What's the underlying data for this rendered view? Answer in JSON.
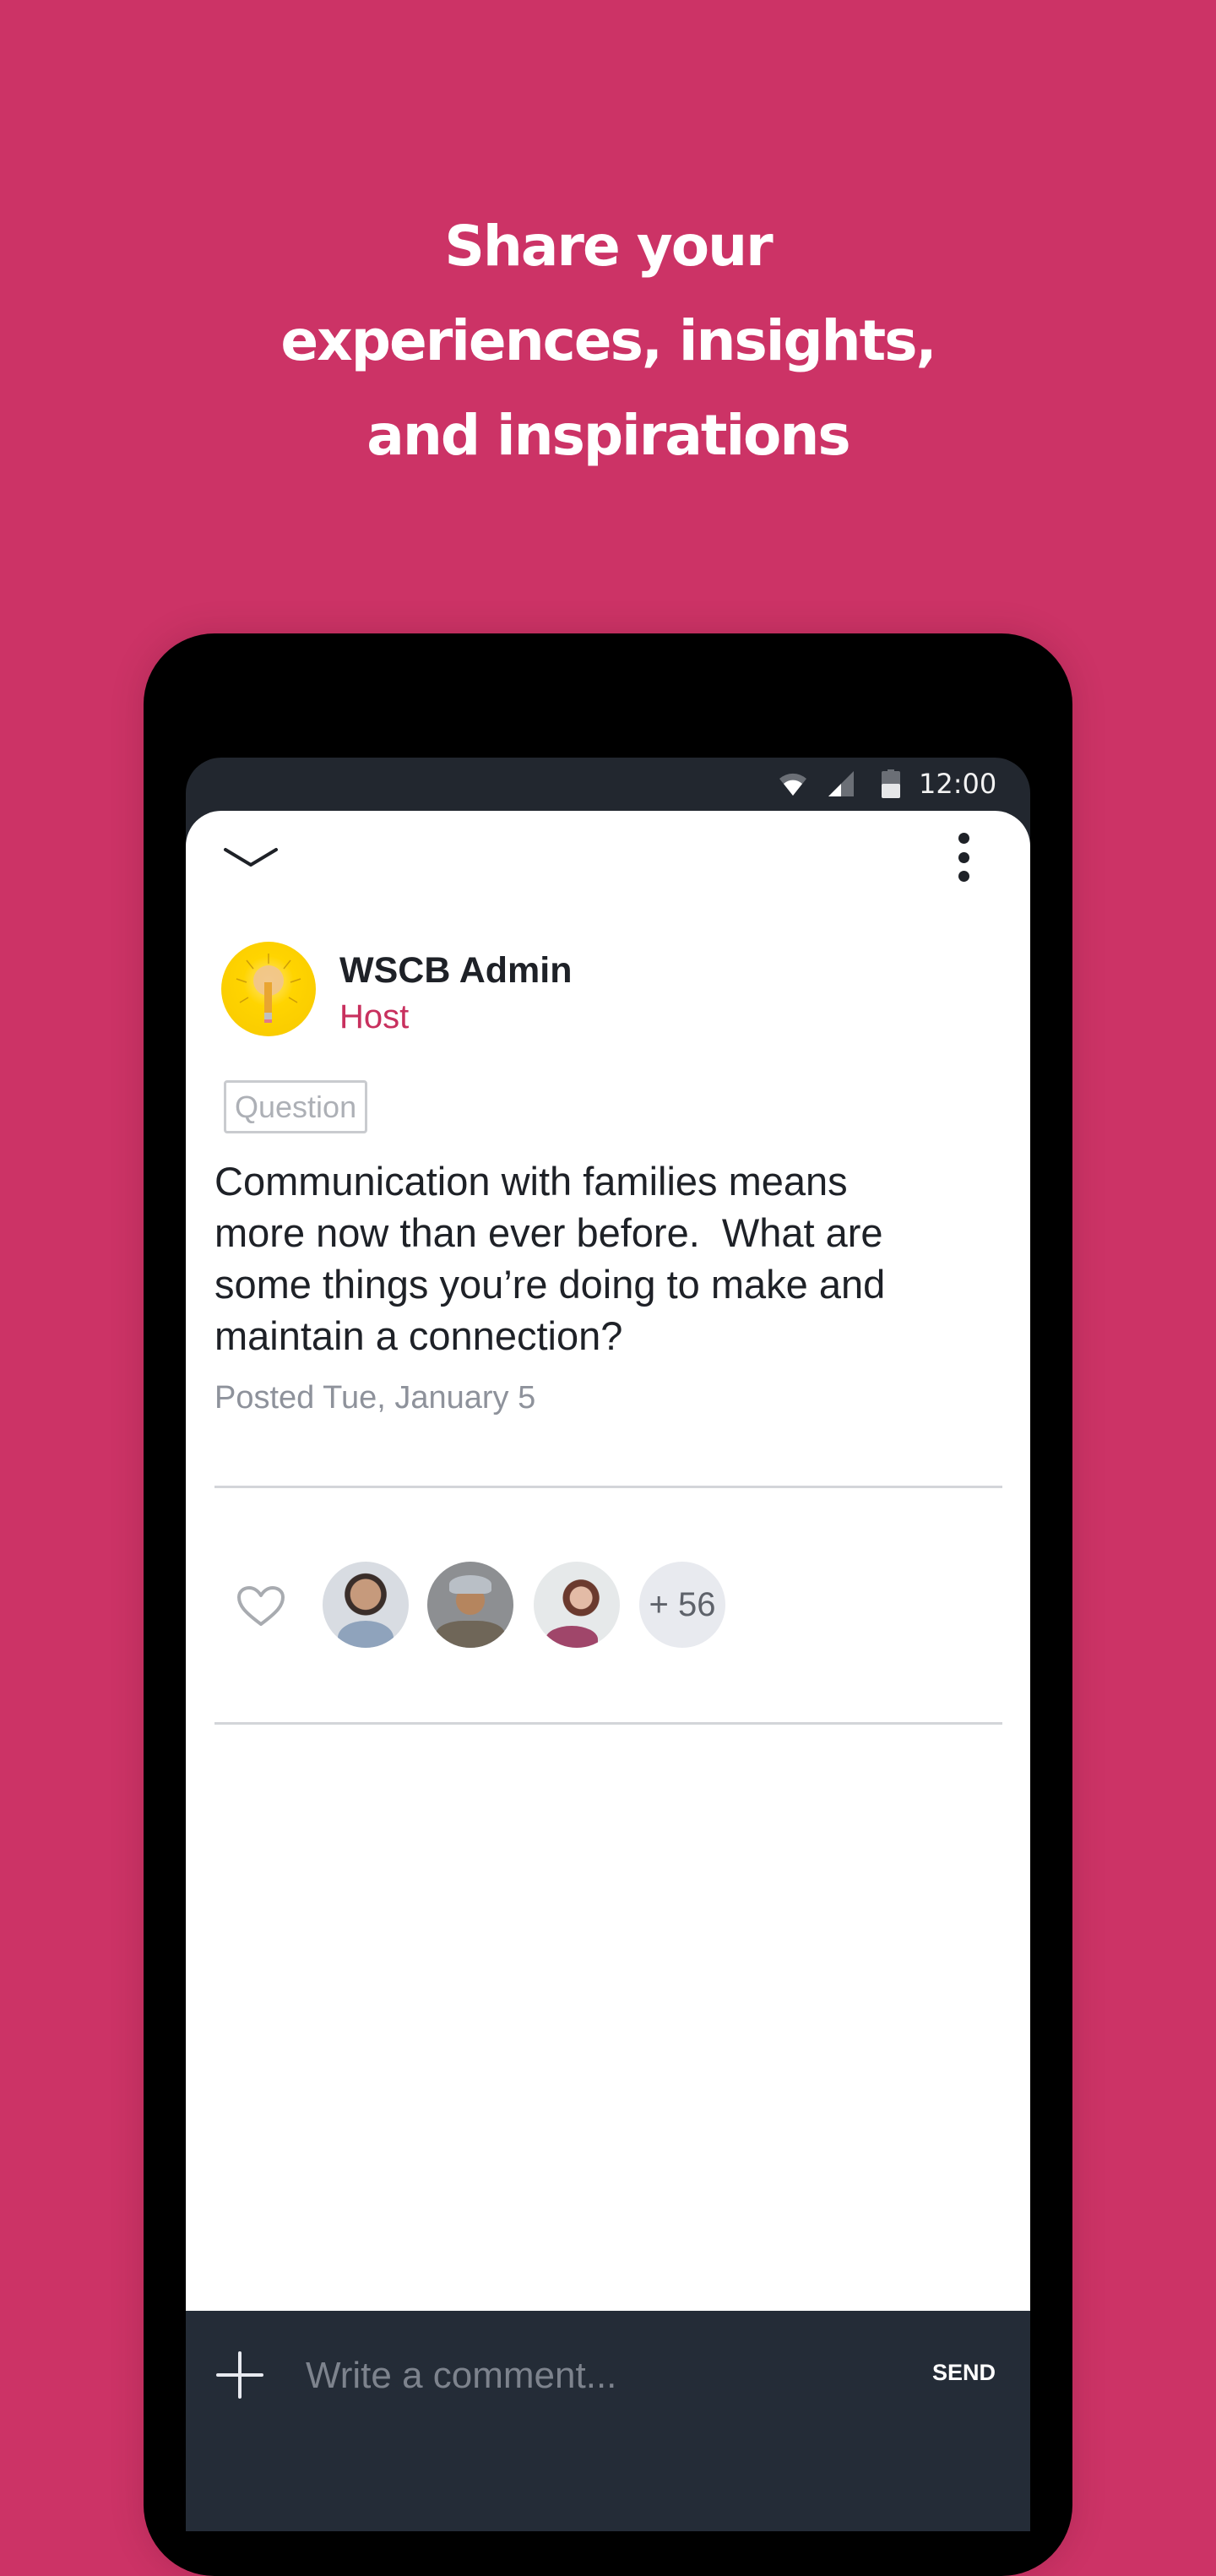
{
  "headline": {
    "lines": [
      "Share your",
      "experiences, insights,",
      "and inspirations"
    ]
  },
  "colors": {
    "background": "#CC3366",
    "accent": "#C8305E",
    "comment_bar": "#242C37"
  },
  "status_bar": {
    "time": "12:00",
    "icons": [
      "wifi-icon",
      "signal-icon",
      "battery-icon"
    ]
  },
  "post": {
    "toolbar": {
      "collapse_icon": "chevron-down-icon",
      "more_icon": "more-vertical-icon"
    },
    "author": {
      "name": "WSCB Admin",
      "role": "Host",
      "avatar": "pencil-lightbulb-avatar"
    },
    "tag": "Question",
    "body": "Communication with families means\nmore now than ever before.  What are\nsome things you’re doing to make and\nmaintain a connection?",
    "posted": "Posted Tue, January 5",
    "likes": {
      "icon": "heart-icon",
      "avatars": [
        "liker-avatar-1",
        "liker-avatar-2",
        "liker-avatar-3"
      ],
      "more_count": "+ 56"
    }
  },
  "comment_bar": {
    "add_icon": "plus-icon",
    "placeholder": "Write a comment...",
    "value": "",
    "send_label": "SEND"
  }
}
